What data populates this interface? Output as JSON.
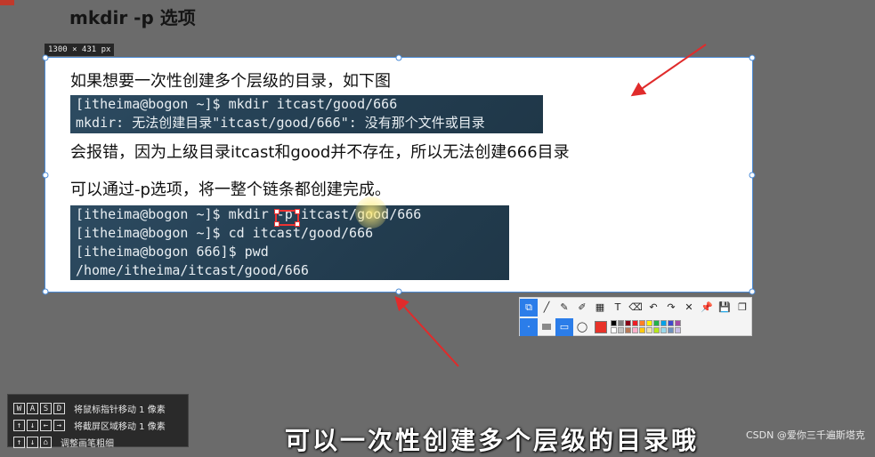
{
  "page": {
    "title": "mkdir -p 选项"
  },
  "selection": {
    "size_label": "1300 × 431  px"
  },
  "slide": {
    "line1": "如果想要一次性创建多个层级的目录，如下图",
    "terminal1": [
      "[itheima@bogon ~]$ mkdir itcast/good/666",
      "mkdir: 无法创建目录\"itcast/good/666\": 没有那个文件或目录"
    ],
    "line2": "会报错，因为上级目录itcast和good并不存在，所以无法创建666目录",
    "line3": "可以通过-p选项，将一整个链条都创建完成。",
    "terminal2": [
      "[itheima@bogon ~]$ mkdir -p itcast/good/666",
      "[itheima@bogon ~]$ cd itcast/good/666",
      "[itheima@bogon 666]$ pwd",
      "/home/itheima/itcast/good/666"
    ]
  },
  "toolbar": {
    "row1": [
      {
        "name": "rect-select-icon",
        "glyph": "⧉",
        "active": true
      },
      {
        "name": "line-icon",
        "glyph": "╱"
      },
      {
        "name": "pen-icon",
        "glyph": "✎"
      },
      {
        "name": "marker-icon",
        "glyph": "✐"
      },
      {
        "name": "mosaic-icon",
        "glyph": "▦"
      },
      {
        "name": "text-icon",
        "glyph": "T"
      },
      {
        "name": "eraser-icon",
        "glyph": "⌫"
      },
      {
        "name": "undo-icon",
        "glyph": "↶"
      },
      {
        "name": "redo-icon",
        "glyph": "↷"
      },
      {
        "name": "close-icon",
        "glyph": "✕"
      },
      {
        "name": "pin-icon",
        "glyph": "📌"
      },
      {
        "name": "save-icon",
        "glyph": "💾"
      },
      {
        "name": "copy-icon",
        "glyph": "❐"
      }
    ],
    "current_color": "#e8332a",
    "palette": [
      "#000000",
      "#7f7f7f",
      "#880015",
      "#ed1c24",
      "#ff7f27",
      "#fff200",
      "#22b14c",
      "#00a2e8",
      "#3f48cc",
      "#a349a4",
      "#ffffff",
      "#c3c3c3",
      "#b97a57",
      "#ffaec9",
      "#ffc90e",
      "#efe4b0",
      "#b5e61d",
      "#99d9ea",
      "#7092be",
      "#c8bfe7"
    ]
  },
  "hints": [
    {
      "keys": [
        "W",
        "A",
        "S",
        "D"
      ],
      "label": "将鼠标指针移动 1 像素"
    },
    {
      "keys": [
        "↑",
        "↓",
        "←",
        "→"
      ],
      "label": "将截屏区域移动 1 像素"
    },
    {
      "keys": [
        "↑",
        "↓",
        "⌂"
      ],
      "label": "调整画笔粗细"
    }
  ],
  "subtitle": "可以一次性创建多个层级的目录哦",
  "watermark": "CSDN @爱你三千遍斯塔克",
  "colors": {
    "accent": "#4b8bd6",
    "arrow": "#e02b2b"
  }
}
